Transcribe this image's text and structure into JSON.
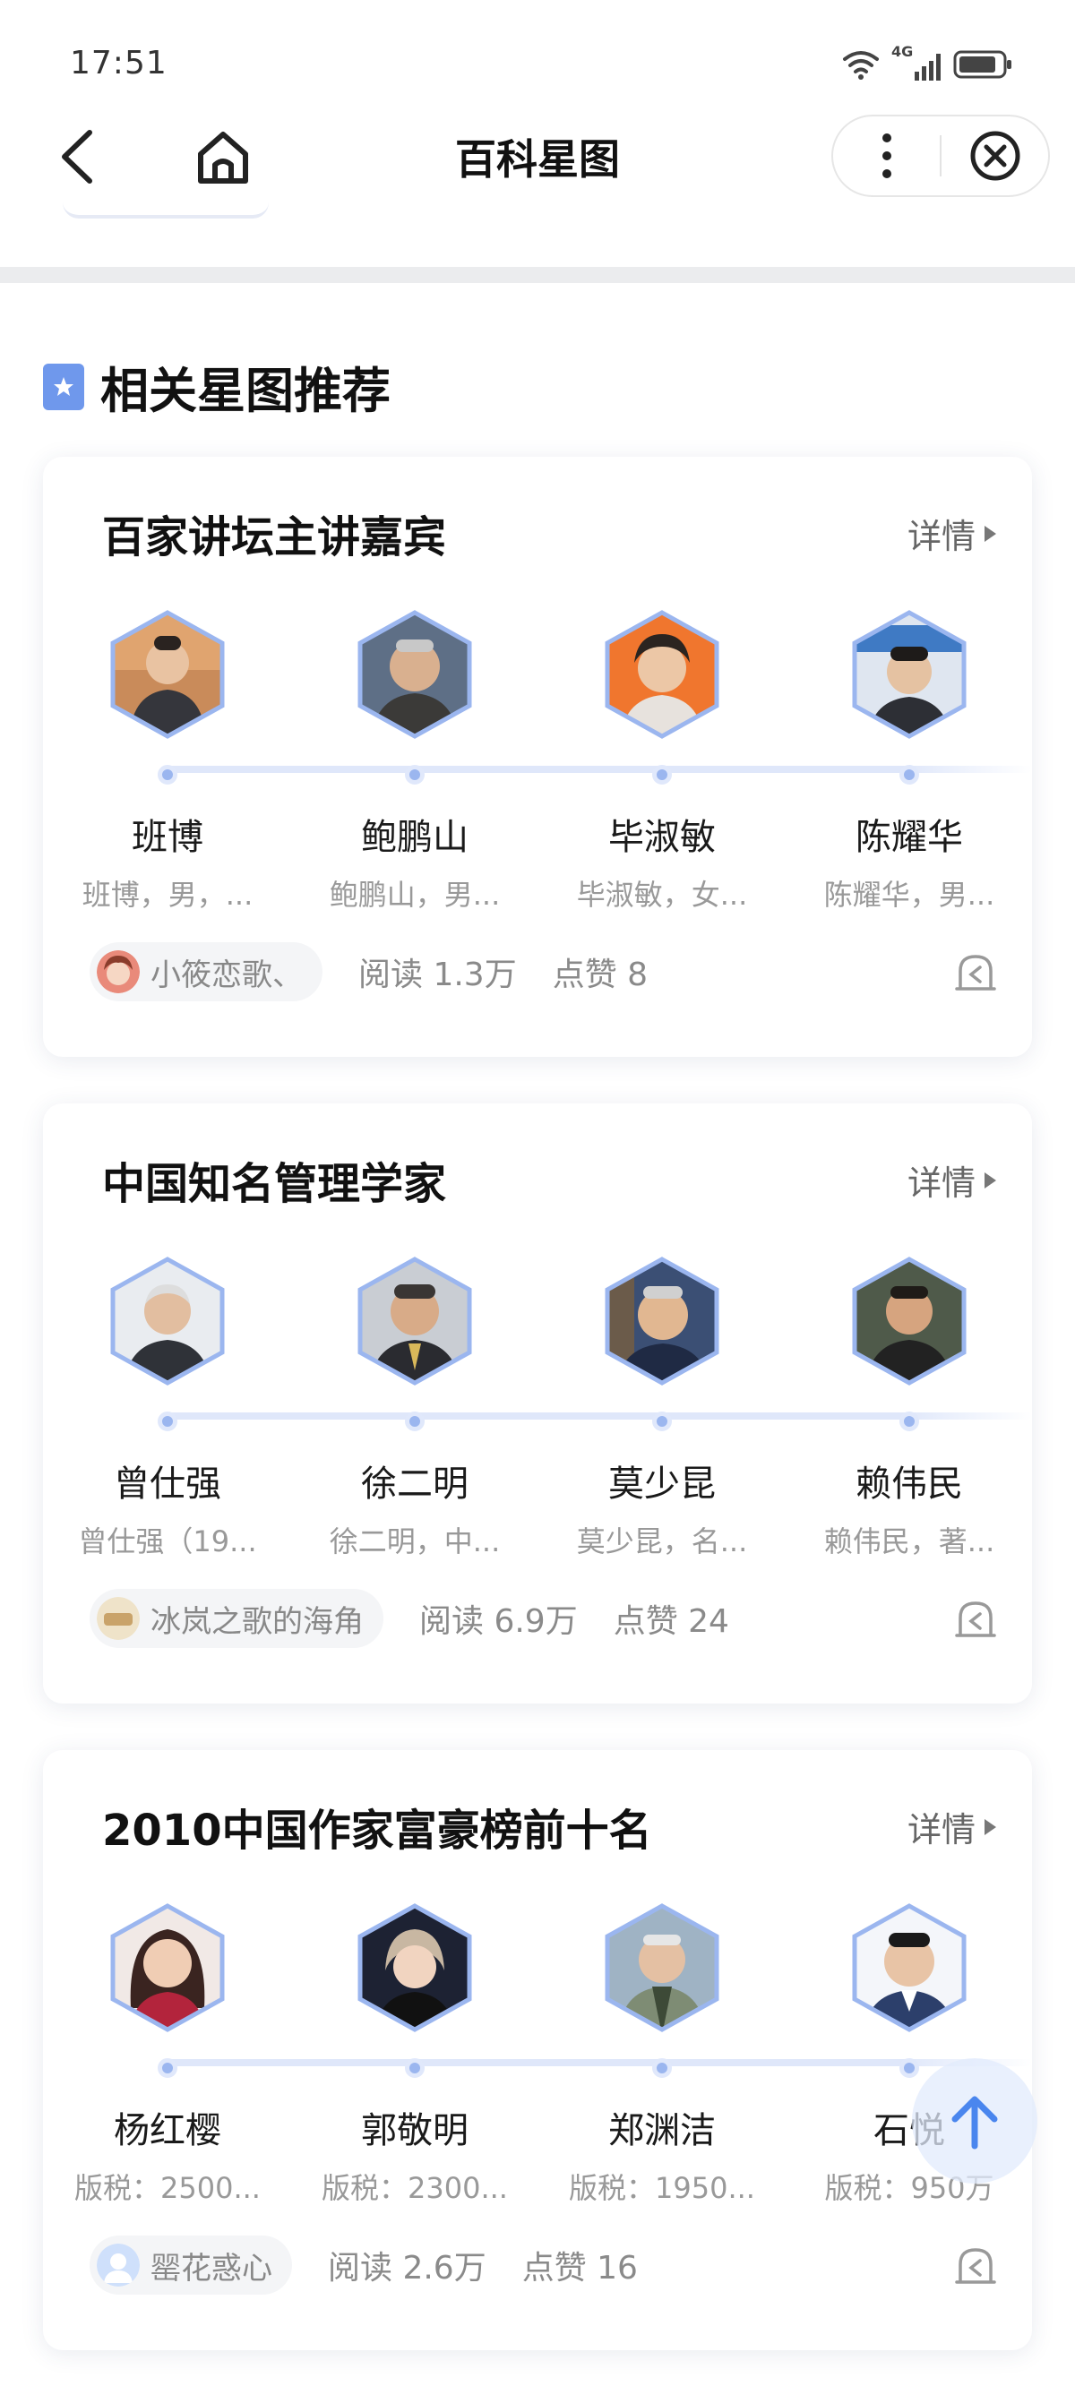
{
  "status_bar": {
    "time": "17:51",
    "network": "4G"
  },
  "nav": {
    "title": "百科星图"
  },
  "section": {
    "title": "相关星图推荐"
  },
  "cards": [
    {
      "title": "百家讲坛主讲嘉宾",
      "detail_label": "详情",
      "people": [
        {
          "name": "班博",
          "desc": "班博，男，..."
        },
        {
          "name": "鲍鹏山",
          "desc": "鲍鹏山，男..."
        },
        {
          "name": "毕淑敏",
          "desc": "毕淑敏，女..."
        },
        {
          "name": "陈耀华",
          "desc": "陈耀华，男..."
        }
      ],
      "author": "小筱恋歌、",
      "reads": "阅读 1.3万",
      "likes": "点赞 8"
    },
    {
      "title": "中国知名管理学家",
      "detail_label": "详情",
      "people": [
        {
          "name": "曾仕强",
          "desc": "曾仕强（19..."
        },
        {
          "name": "徐二明",
          "desc": "徐二明，中..."
        },
        {
          "name": "莫少昆",
          "desc": "莫少昆，名..."
        },
        {
          "name": "赖伟民",
          "desc": "赖伟民，著..."
        }
      ],
      "author": "冰岚之歌的海角",
      "reads": "阅读 6.9万",
      "likes": "点赞 24"
    },
    {
      "title": "2010中国作家富豪榜前十名",
      "detail_label": "详情",
      "people": [
        {
          "name": "杨红樱",
          "desc": "版税：2500..."
        },
        {
          "name": "郭敬明",
          "desc": "版税：2300..."
        },
        {
          "name": "郑渊洁",
          "desc": "版税：1950..."
        },
        {
          "name": "石悦",
          "desc": "版税：950万"
        }
      ],
      "author": "罂花惑心",
      "reads": "阅读 2.6万",
      "likes": "点赞 16"
    }
  ],
  "colors": {
    "accent": "#6f98ec",
    "timeline": "#dfe7fa",
    "avatar_border": "#9bb6ef"
  }
}
